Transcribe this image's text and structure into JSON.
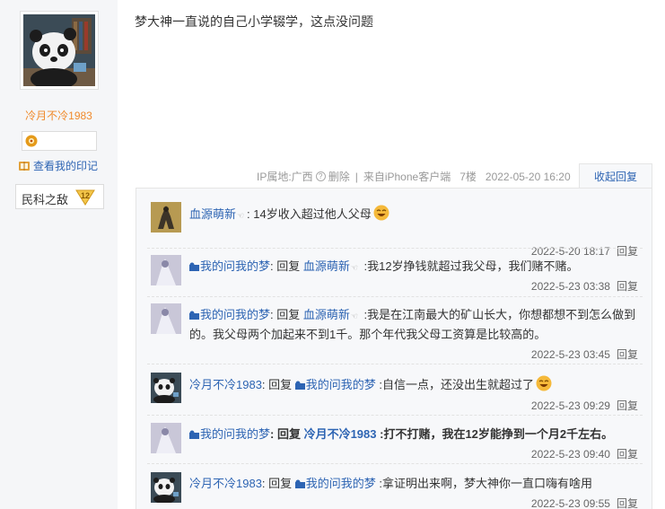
{
  "author": {
    "name": "冷月不冷1983",
    "mark_link": "查看我的印记",
    "title_badge": "民科之敌",
    "title_level": "12"
  },
  "post": {
    "text": "梦大神一直说的自己小学辍学，这点没问题",
    "ip": "IP属地:广西",
    "delete": "删除",
    "client": "来自iPhone客户端",
    "floor": "7楼",
    "time": "2022-05-20 16:20",
    "collapse": "收起回复"
  },
  "replies": [
    {
      "user": "血源萌新",
      "text": ": 14岁收入超过他人父母",
      "time": "2022-5-20 18:17",
      "reply_label": "回复"
    },
    {
      "user": "我的问我的梦",
      "reply_word": ": 回复 ",
      "target": "血源萌新",
      "text": " :我12岁挣钱就超过我父母，我们赌不赌。",
      "time": "2022-5-23 03:38",
      "reply_label": "回复"
    },
    {
      "user": "我的问我的梦",
      "reply_word": ": 回复 ",
      "target": "血源萌新",
      "text": " :我是在江南最大的矿山长大，你想都想不到怎么做到的。我父母两个加起来不到1千。那个年代我父母工资算是比较高的。",
      "time": "2022-5-23 03:45",
      "reply_label": "回复"
    },
    {
      "user": "冷月不冷1983",
      "reply_word": ": 回复 ",
      "target": "我的问我的梦",
      "text": " :自信一点，还没出生就超过了",
      "time": "2022-5-23 09:29",
      "reply_label": "回复"
    },
    {
      "user": "我的问我的梦",
      "reply_word": ": 回复 ",
      "target": "冷月不冷1983",
      "text": " :打不打赌，我在12岁能挣到一个月2千左右。",
      "time": "2022-5-23 09:40",
      "reply_label": "回复"
    },
    {
      "user": "冷月不冷1983",
      "reply_word": ": 回复 ",
      "target": "我的问我的梦",
      "text": " :拿证明出来啊，梦大神你一直口嗨有啥用",
      "time": "2022-5-23 09:55",
      "reply_label": "回复"
    }
  ],
  "colors": {
    "link": "#2d64b3",
    "author_name": "#f08a2b",
    "panel_bg": "#f7f8fa",
    "sidebar_bg": "#f5f6f8"
  }
}
